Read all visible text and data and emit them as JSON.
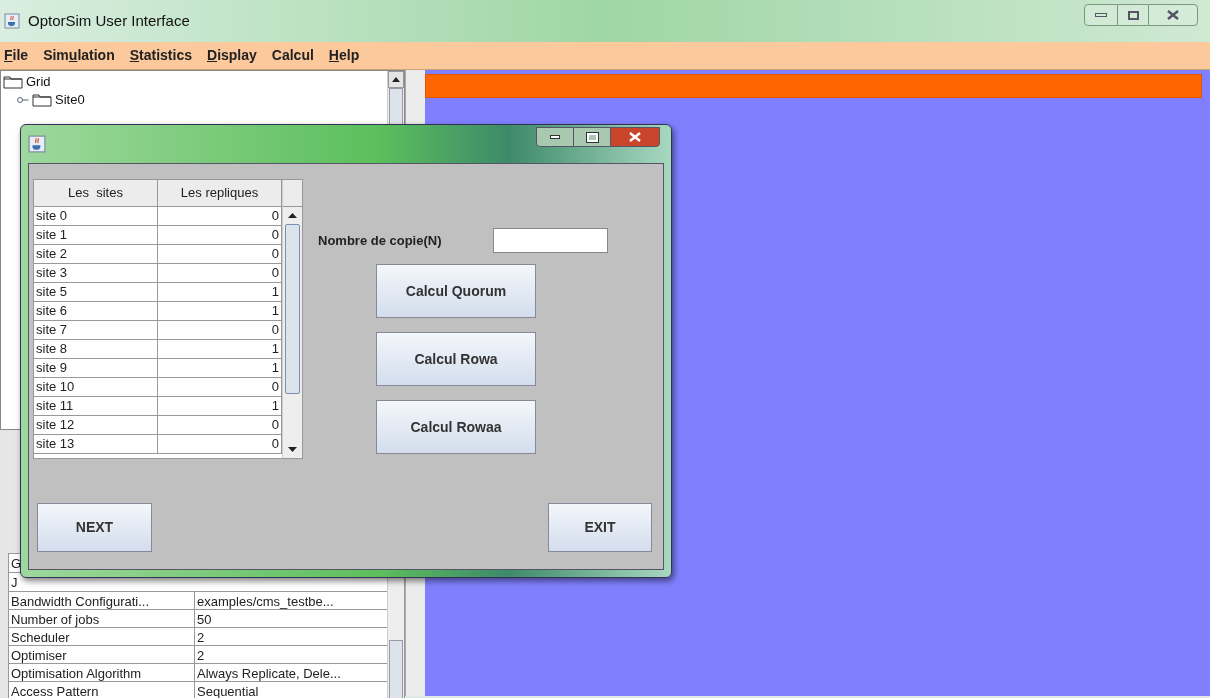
{
  "window": {
    "title": "OptorSim User Interface"
  },
  "menu": [
    {
      "key": "F",
      "after": "ile"
    },
    {
      "before": "Sim",
      "key": "u",
      "after": "lation"
    },
    {
      "key": "S",
      "after": "tatistics"
    },
    {
      "key": "D",
      "after": "isplay"
    },
    {
      "before": "Calcul"
    },
    {
      "key": "H",
      "after": "elp"
    }
  ],
  "tree": [
    {
      "label": "Grid",
      "children": [
        {
          "label": "Site0",
          "expanded": false
        }
      ]
    }
  ],
  "properties": {
    "hidden_rows": [
      "G",
      "J"
    ],
    "rows": [
      {
        "name": "Bandwidth Configurati...",
        "value": "examples/cms_testbe..."
      },
      {
        "name": "Number of jobs",
        "value": "50"
      },
      {
        "name": "Scheduler",
        "value": "2"
      },
      {
        "name": "Optimiser",
        "value": "2"
      },
      {
        "name": "Optimisation Algorithm",
        "value": "Always Replicate, Dele..."
      },
      {
        "name": "Access Pattern",
        "value": "Sequential"
      }
    ]
  },
  "dialog": {
    "table": {
      "columns": [
        "Les  sites",
        "Les repliques"
      ],
      "rows": [
        [
          "site 0",
          "0"
        ],
        [
          "site 1",
          "0"
        ],
        [
          "site 2",
          "0"
        ],
        [
          "site 3",
          "0"
        ],
        [
          "site 5",
          "1"
        ],
        [
          "site 6",
          "1"
        ],
        [
          "site 7",
          "0"
        ],
        [
          "site 8",
          "1"
        ],
        [
          "site 9",
          "1"
        ],
        [
          "site 10",
          "0"
        ],
        [
          "site 11",
          "1"
        ],
        [
          "site 12",
          "0"
        ],
        [
          "site 13",
          "0"
        ]
      ]
    },
    "copies_label": "Nombre de copie(N)",
    "buttons": [
      "Calcul Quorum",
      "Calcul Rowa",
      "Calcul Rowaa"
    ],
    "next": "NEXT",
    "exit": "EXIT"
  }
}
